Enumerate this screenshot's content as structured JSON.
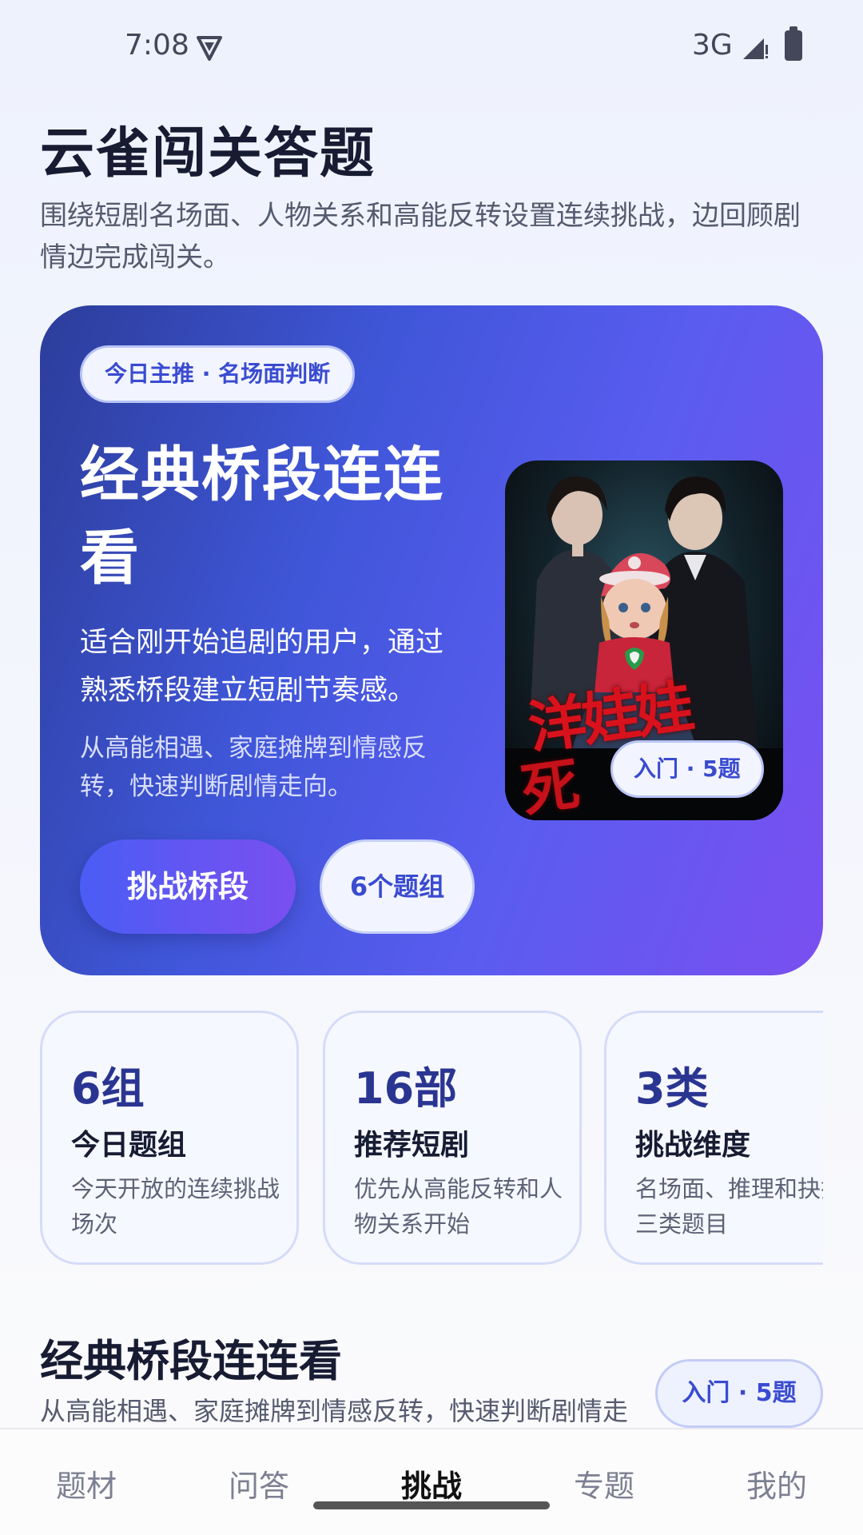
{
  "status_bar": {
    "time": "7:08",
    "network": "3G"
  },
  "header": {
    "title": "云雀闯关答题",
    "subtitle": "围绕短剧名场面、人物关系和高能反转设置连续挑战，边回顾剧情边完成闯关。"
  },
  "hero": {
    "badge": "今日主推 · 名场面判断",
    "title": "经典桥段连连看",
    "description": "适合刚开始追剧的用户，通过熟悉桥段建立短剧节奏感。",
    "note": "从高能相遇、家庭摊牌到情感反转，快速判断剧情走向。",
    "primary_button": "挑战桥段",
    "secondary_button": "6个题组",
    "poster": {
      "title_art_line1": "洋娃娃",
      "title_art_line2": "死",
      "tag": "入门 · 5题"
    }
  },
  "stats": [
    {
      "value": "6组",
      "label": "今日题组",
      "desc": "今天开放的连续挑战场次"
    },
    {
      "value": "16部",
      "label": "推荐短剧",
      "desc": "优先从高能反转和人物关系开始"
    },
    {
      "value": "3类",
      "label": "挑战维度",
      "desc": "名场面、推理和抉择三类题目"
    }
  ],
  "section": {
    "title": "经典桥段连连看",
    "desc": "从高能相遇、家庭摊牌到情感反转，快速判断剧情走",
    "tag": "入门 · 5题"
  },
  "nav": {
    "items": [
      {
        "label": "题材",
        "active": false
      },
      {
        "label": "问答",
        "active": false
      },
      {
        "label": "挑战",
        "active": true
      },
      {
        "label": "专题",
        "active": false
      },
      {
        "label": "我的",
        "active": false
      }
    ]
  }
}
